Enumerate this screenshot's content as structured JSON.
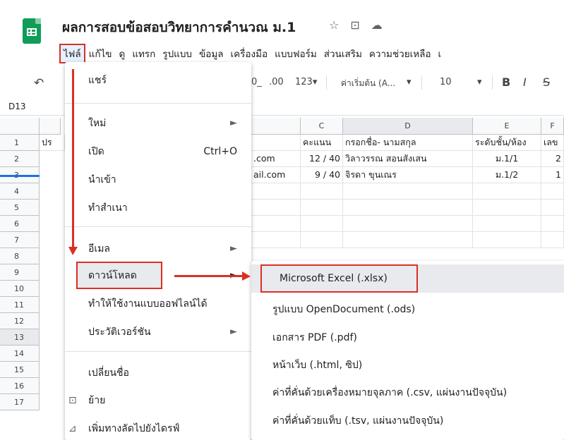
{
  "doc": {
    "title": "ผลการสอบข้อสอบวิทยาการคำนวณ ม.1",
    "star_icon": "star-icon",
    "move_icon": "move-to-folder-icon",
    "cloud_icon": "cloud-status-icon"
  },
  "menubar": [
    "ไฟล์",
    "แก้ไข",
    "ดู",
    "แทรก",
    "รูปแบบ",
    "ข้อมูล",
    "เครื่องมือ",
    "แบบฟอร์ม",
    "ส่วนเสริม",
    "ความช่วยเหลือ",
    "เ"
  ],
  "toolbar": {
    "undo_icon": "undo-icon",
    "decimal_dec": "0_",
    "decimal_inc": ".00",
    "format_num": "123▾",
    "font": "ค่าเริ่มต้น (A...",
    "font_size": "10",
    "bold": "B",
    "italic": "I",
    "strike": "S"
  },
  "namebox": "D13",
  "columns": [
    "C",
    "D",
    "E",
    "F"
  ],
  "rows": [
    "1",
    "2",
    "3",
    "4",
    "5",
    "6",
    "7",
    "8",
    "9",
    "10",
    "11",
    "12",
    "13",
    "14",
    "15",
    "16",
    "17"
  ],
  "cells": {
    "r1_a": "ปร",
    "r1_c": "คะแนน",
    "r1_d": "กรอกชื่อ- นามสกุล",
    "r1_e": "ระดับชั้น/ห้อง",
    "r1_f": "เลข",
    "r2_b": ".com",
    "r2_c": "12 / 40",
    "r2_d": "วิลาวรรณ สอนสังเสน",
    "r2_e": "ม.1/1",
    "r2_f": "2",
    "r3_b": "ail.com",
    "r3_c": "9 / 40",
    "r3_d": "จิรดา  ขุนเณร",
    "r3_e": "ม.1/2",
    "r3_f": "1"
  },
  "file_menu": {
    "share": "แชร์",
    "new": "ใหม่",
    "open": "เปิด",
    "open_shortcut": "Ctrl+O",
    "import": "นำเข้า",
    "copy": "ทำสำเนา",
    "email": "อีเมล",
    "download": "ดาวน์โหลด",
    "offline": "ทำให้ใช้งานแบบออฟไลน์ได้",
    "version_history": "ประวัติเวอร์ชัน",
    "rename": "เปลี่ยนชื่อ",
    "move": "ย้าย",
    "add_shortcut": "เพิ่มทางลัดไปยังไดรฟ์",
    "submenu_arrow": "►"
  },
  "download_menu": [
    "Microsoft Excel (.xlsx)",
    "รูปแบบ OpenDocument (.ods)",
    "เอกสาร PDF (.pdf)",
    "หน้าเว็บ (.html, ซิป)",
    "ค่าที่คั่นด้วยเครื่องหมายจุลภาค (.csv, แผ่นงานปัจจุบัน)",
    "ค่าที่คั่นด้วยแท็บ (.tsv, แผ่นงานปัจจุบัน)"
  ],
  "colors": {
    "accent": "#d93025",
    "brand": "#0f9d58",
    "select": "#1a73e8"
  }
}
